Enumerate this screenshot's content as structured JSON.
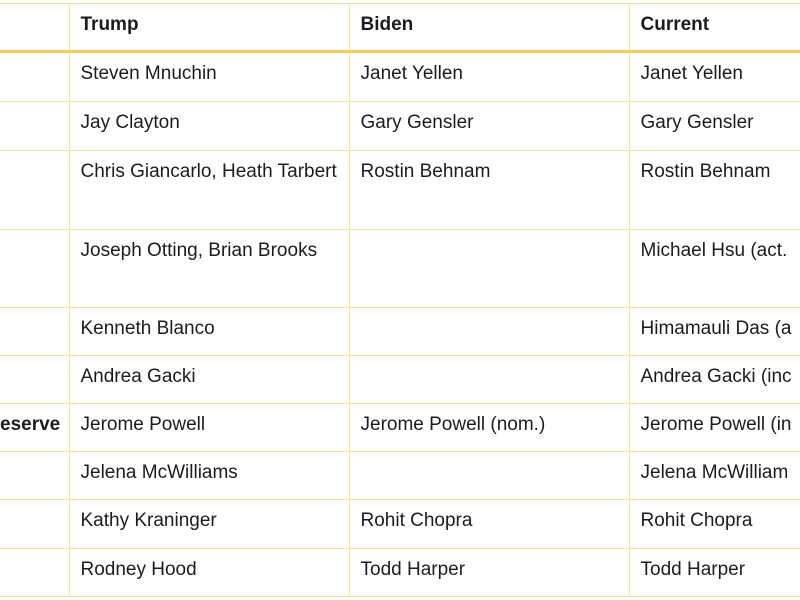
{
  "table": {
    "headers": [
      "",
      "Trump",
      "Biden",
      "Current"
    ],
    "rows": [
      {
        "agency": "",
        "trump": "Steven Mnuchin",
        "biden": "Janet Yellen",
        "current": "Janet Yellen"
      },
      {
        "agency": "",
        "trump": "Jay Clayton",
        "biden": "Gary Gensler",
        "current": "Gary Gensler"
      },
      {
        "agency": "",
        "trump": "Chris Giancarlo, Heath Tarbert",
        "biden": "Rostin Behnam",
        "current": "Rostin Behnam"
      },
      {
        "agency": "",
        "trump": "Joseph Otting, Brian Brooks",
        "biden": "",
        "current": "Michael Hsu (act."
      },
      {
        "agency": "",
        "trump": "Kenneth Blanco",
        "biden": "",
        "current": "Himamauli Das (a"
      },
      {
        "agency": "",
        "trump": "Andrea Gacki",
        "biden": "",
        "current": "Andrea Gacki (inc"
      },
      {
        "agency": "eserve",
        "trump": "Jerome Powell",
        "biden": "Jerome Powell (nom.)",
        "current": "Jerome Powell (in"
      },
      {
        "agency": "",
        "trump": "Jelena McWilliams",
        "biden": "",
        "current": "Jelena McWilliam"
      },
      {
        "agency": "",
        "trump": "Kathy Kraninger",
        "biden": "Rohit Chopra",
        "current": "Rohit Chopra"
      },
      {
        "agency": "",
        "trump": "Rodney Hood",
        "biden": "Todd Harper",
        "current": "Todd Harper"
      }
    ]
  },
  "colors": {
    "border": "#f7e3a0",
    "header_rule": "#f3cf63",
    "text": "#1c1c1c"
  }
}
